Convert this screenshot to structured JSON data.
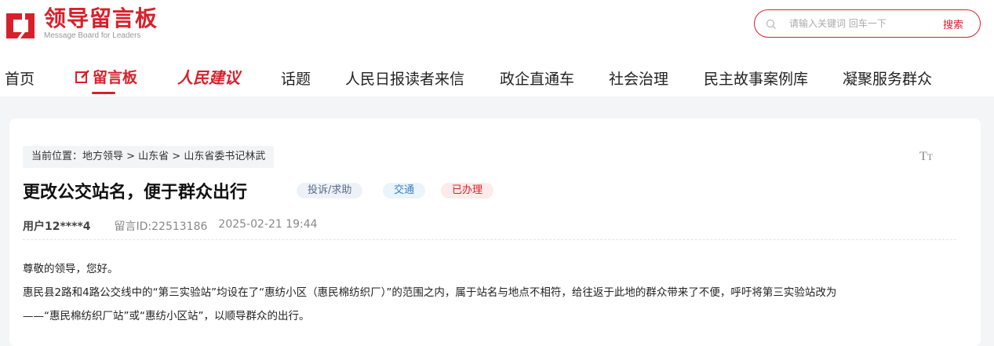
{
  "brand": {
    "title": "领导留言板",
    "subtitle": "Message Board for Leaders",
    "color": "#d8202c"
  },
  "search": {
    "placeholder": "请输入关键词 回车一下",
    "button_label": "搜索"
  },
  "nav": {
    "items": [
      {
        "label": "首页"
      },
      {
        "label": "留言板",
        "active": true,
        "icon": "edit-icon"
      },
      {
        "label": "人民建议"
      },
      {
        "label": "话题"
      },
      {
        "label": "人民日报读者来信"
      },
      {
        "label": "政企直通车"
      },
      {
        "label": "社会治理"
      },
      {
        "label": "民主故事案例库"
      },
      {
        "label": "凝聚服务群众"
      }
    ]
  },
  "breadcrumb": "当前位置：地方领导 > 山东省 > 山东省委书记林武",
  "font_size_icon": "font-size-icon",
  "message": {
    "title": "更改公交站名，便于群众出行",
    "tags": [
      "投诉/求助",
      "交通",
      "已办理"
    ],
    "user": "用户12****4",
    "id_label": "留言ID:22513186",
    "datetime": "2025-02-21 19:44",
    "body": [
      "尊敬的领导，您好。",
      "惠民县2路和4路公交线中的“第三实验站”均设在了“惠纺小区（惠民棉纺织厂）”的范围之内，属于站名与地点不相符，给往返于此地的群众带来了不便，呼吁将第三实验站改为",
      "——“惠民棉纺织厂站”或“惠纺小区站”，以顺导群众的出行。"
    ]
  }
}
